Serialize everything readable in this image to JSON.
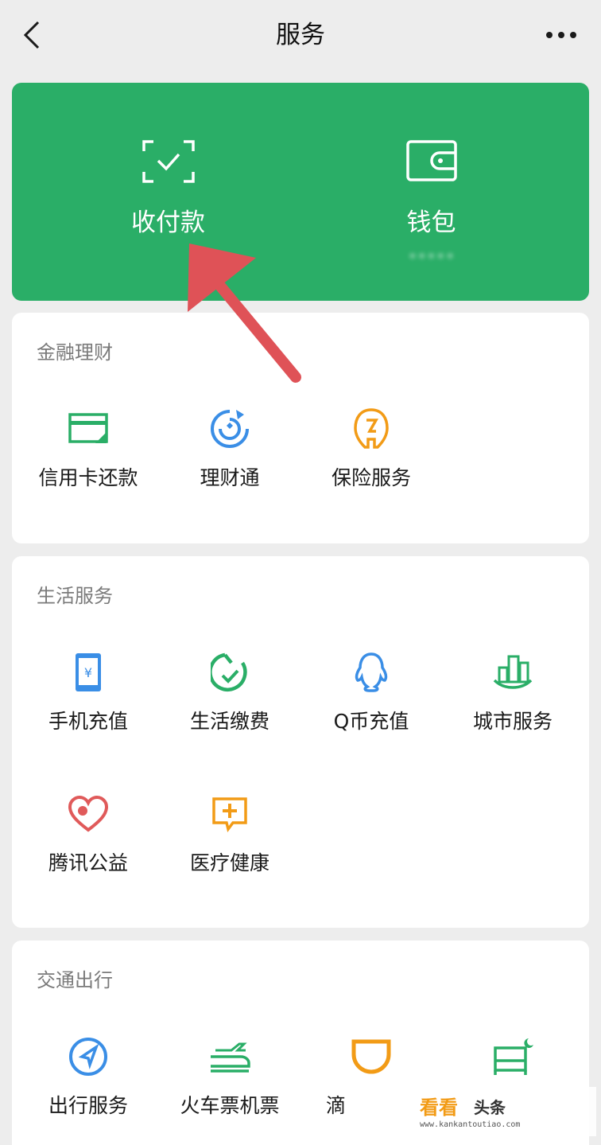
{
  "header": {
    "title": "服务",
    "back_icon": "chevron-left-icon",
    "more_icon": "more-dots-icon"
  },
  "top_card": {
    "color": "#2aae67",
    "items": [
      {
        "label": "收付款",
        "icon": "scan-check-icon"
      },
      {
        "label": "钱包",
        "icon": "wallet-icon",
        "sub": "•••••"
      }
    ]
  },
  "sections": {
    "finance": {
      "title": "金融理财",
      "items": [
        {
          "label": "信用卡还款",
          "icon": "credit-card-icon",
          "color": "#2aae67"
        },
        {
          "label": "理财通",
          "icon": "wealth-icon",
          "color": "#3a8ee6"
        },
        {
          "label": "保险服务",
          "icon": "insurance-icon",
          "color": "#f29b16"
        }
      ]
    },
    "life": {
      "title": "生活服务",
      "items": [
        {
          "label": "手机充值",
          "icon": "phone-topup-icon",
          "color": "#3a8ee6"
        },
        {
          "label": "生活缴费",
          "icon": "bill-pay-icon",
          "color": "#2aae67"
        },
        {
          "label": "Q币充值",
          "icon": "qq-coin-icon",
          "color": "#3a8ee6"
        },
        {
          "label": "城市服务",
          "icon": "city-service-icon",
          "color": "#2aae67"
        },
        {
          "label": "腾讯公益",
          "icon": "charity-icon",
          "color": "#e05a5a"
        },
        {
          "label": "医疗健康",
          "icon": "medical-icon",
          "color": "#f29b16"
        }
      ]
    },
    "transport": {
      "title": "交通出行",
      "items": [
        {
          "label": "出行服务",
          "icon": "navigation-icon",
          "color": "#3a8ee6"
        },
        {
          "label": "火车票机票",
          "icon": "train-plane-icon",
          "color": "#2aae67"
        },
        {
          "label": "滴",
          "icon": "didi-icon",
          "color": "#f29b16"
        },
        {
          "label": "",
          "icon": "hotel-icon",
          "color": "#2aae67"
        }
      ]
    }
  },
  "watermark": {
    "text_main": "看看",
    "text_sub": "头条",
    "url": "www.kankantoutiao.com"
  }
}
